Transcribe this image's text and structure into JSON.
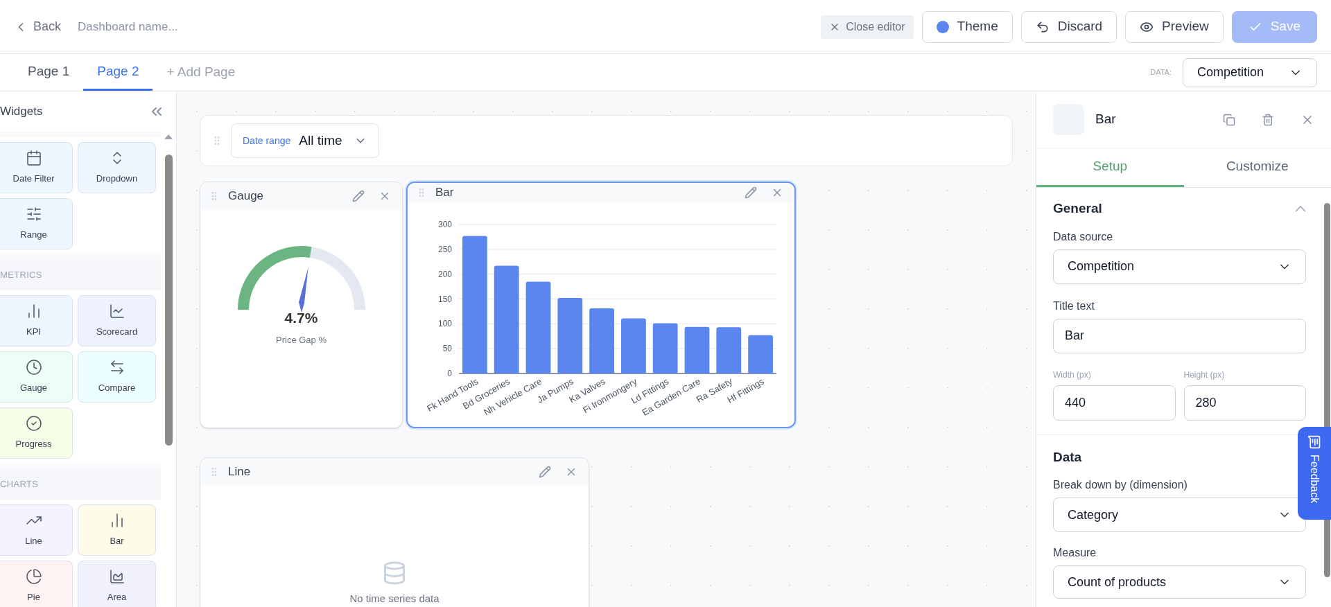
{
  "top_bar": {
    "back": "Back",
    "dashboard_name_placeholder": "Dashboard name...",
    "close_editor": "Close editor",
    "theme": {
      "label": "Theme",
      "color": "#5b86ee"
    },
    "discard": "Discard",
    "preview": "Preview",
    "save": {
      "label": "Save",
      "disabled": true
    }
  },
  "page_tabs": [
    {
      "label": "Page 1",
      "selected": false
    },
    {
      "label": "Page 2",
      "selected": true
    }
  ],
  "add_page": "+ Add Page",
  "data_select": {
    "label": "DATA:",
    "value": "Competition"
  },
  "sidebar": {
    "title": "Widgets",
    "sections": [
      {
        "items": [
          {
            "label": "Date Filter",
            "color": "#eff6ff"
          },
          {
            "label": "Dropdown",
            "color": "#eff6ff"
          },
          {
            "label": "Range",
            "color": "#eff6ff"
          }
        ]
      },
      {
        "heading": "METRICS",
        "items": [
          {
            "label": "KPI",
            "color": "#eff5ff"
          },
          {
            "label": "Scorecard",
            "color": "#eef2ff"
          },
          {
            "label": "Gauge",
            "color": "#effdf7"
          },
          {
            "label": "Compare",
            "color": "#ecfeff"
          },
          {
            "label": "Progress",
            "color": "#f7fee7"
          }
        ]
      },
      {
        "heading": "CHARTS",
        "items": [
          {
            "label": "Line",
            "color": "#f5f3ff"
          },
          {
            "label": "Bar",
            "color": "#fefce8"
          },
          {
            "label": "Pie",
            "color": "#fef2f2"
          },
          {
            "label": "Area",
            "color": "#f1f1fd"
          }
        ]
      }
    ]
  },
  "date_filter": {
    "label": "Date range",
    "value": "All time"
  },
  "gauge_widget": {
    "title": "Gauge",
    "value": "4.7%",
    "caption": "Price Gap %",
    "level": 0.55,
    "selected": false
  },
  "bar_widget": {
    "title": "Bar",
    "selected": true,
    "chart_data": {
      "type": "bar",
      "categories": [
        "Fk Hand Tools",
        "Bd Groceries",
        "Nh Vehicle Care",
        "Ja Pumps",
        "Ka Valves",
        "Fi Ironmongery",
        "Ld Fittings",
        "Ea Garden Care",
        "Ra Safety",
        "Hf Fittings"
      ],
      "grid": true,
      "series": [
        {
          "color": "#5b86ee",
          "values": [
            277,
            217,
            185,
            152,
            131,
            111,
            101,
            94,
            93,
            77
          ]
        }
      ],
      "ylim": [
        0,
        300
      ],
      "yticks": [
        0,
        50,
        100,
        150,
        200,
        250,
        300
      ]
    }
  },
  "line_widget": {
    "title": "Line",
    "empty_message": "No time series data",
    "selected": false
  },
  "inspector": {
    "title": "Bar",
    "tabs": [
      {
        "label": "Setup",
        "selected": true
      },
      {
        "label": "Customize",
        "selected": false
      }
    ],
    "general": {
      "heading": "General",
      "expanded": true,
      "data_source_label": "Data source",
      "data_source": "Competition",
      "title_label": "Title text",
      "title_value": "Bar",
      "width_label": "Width (px)",
      "width_value": "440",
      "height_label": "Height (px)",
      "height_value": "280"
    },
    "data": {
      "heading": "Data",
      "breakdown_label": "Break down by (dimension)",
      "breakdown": "Category",
      "measure_label": "Measure",
      "measure": "Count of products"
    }
  },
  "feedback": "Feedback"
}
